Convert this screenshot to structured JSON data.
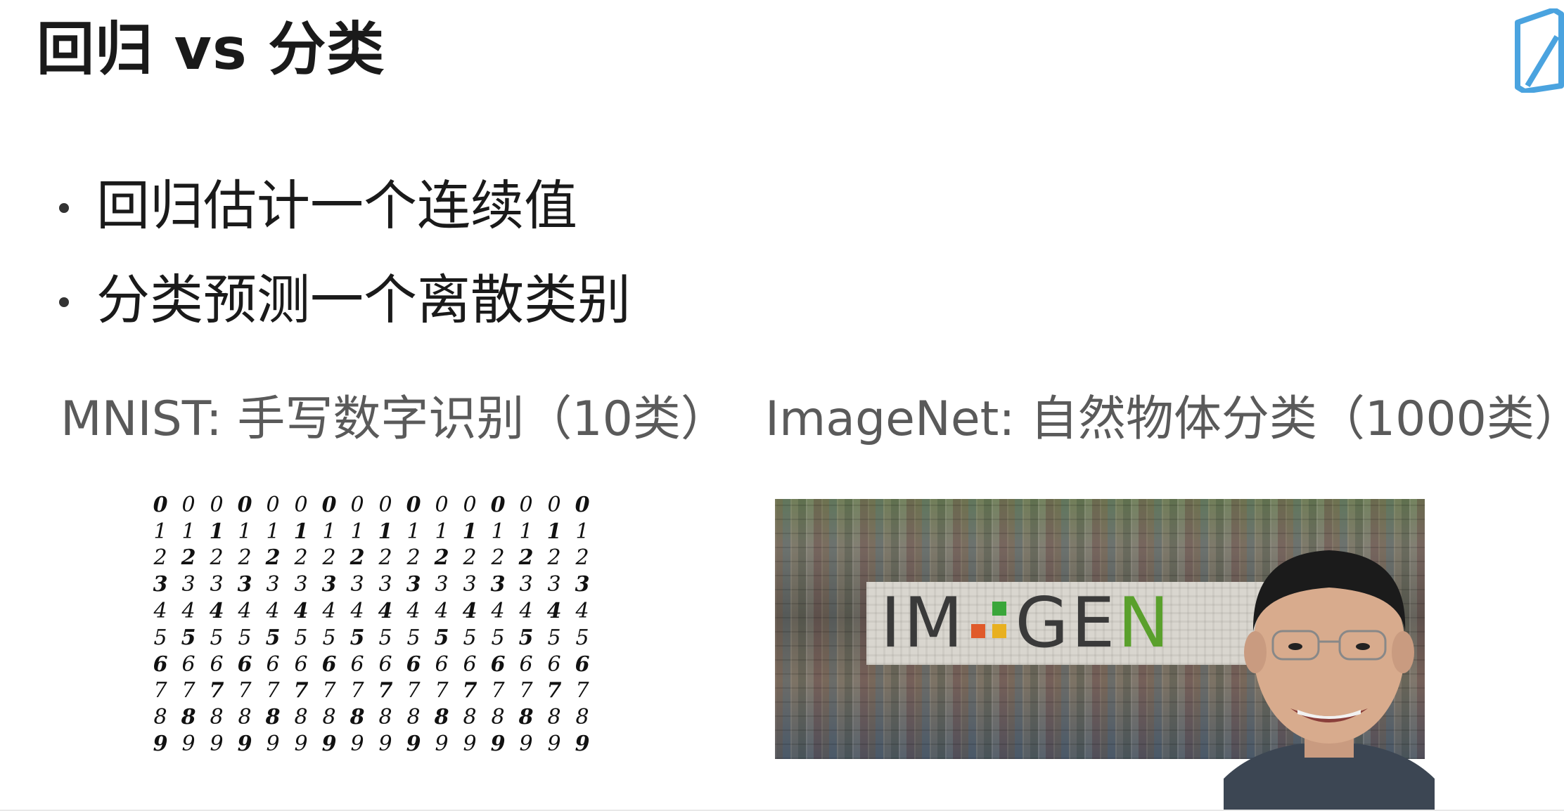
{
  "slide": {
    "title": "回归 vs 分类",
    "bullets": [
      "回归估计一个连续值",
      "分类预测一个离散类别"
    ]
  },
  "captions": {
    "mnist": "MNIST: 手写数字识别（10类）",
    "imagenet": "ImageNet: 自然物体分类（1000类）"
  },
  "mnist_rows": [
    "0000000000000000",
    "1111111111111111",
    "2222222222222222",
    "3333333333333333",
    "4444444444444444",
    "5555555555555555",
    "6666666666666666",
    "7777777777777777",
    "8888888888888888",
    "9999999999999999"
  ],
  "imagenet_logo": {
    "prefix": "IM",
    "middle": "GE",
    "n": "N",
    "dot_colors": [
      "#3aa63a",
      "#e05a2a",
      "#e8b020",
      "#c8282a"
    ]
  },
  "logo_color": "#4aa3df"
}
